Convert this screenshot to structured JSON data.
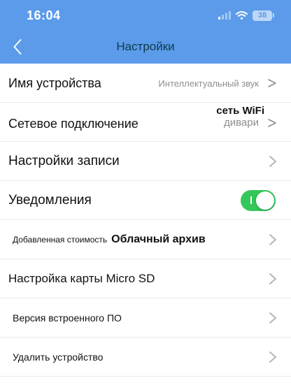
{
  "status_bar": {
    "time": "16:04",
    "battery": "38"
  },
  "header": {
    "title": "Настройки"
  },
  "rows": {
    "device_name": {
      "label": "Имя устройства",
      "value": "Интеллектуальный звук"
    },
    "network": {
      "label": "Сетевое подключение",
      "value_top": "сеть WiFi",
      "value": "дивари"
    },
    "recording": {
      "label": "Настройки записи"
    },
    "notifications": {
      "label": "Уведомления",
      "enabled": true
    },
    "cloud": {
      "label_prefix": "Добавленная стоимость",
      "label_bold": "Облачный архив"
    },
    "sdcard": {
      "label": "Настройка карты Micro SD"
    },
    "firmware": {
      "label": "Версия встроенного ПО"
    },
    "delete": {
      "label": "Удалить устройство"
    }
  },
  "colors": {
    "header": "#5b9bea",
    "toggle_on": "#34c759",
    "chevron": "#b5b5b5"
  },
  "icons": {
    "back": "chevron-left-icon",
    "row_arrow": "chevron-right-icon",
    "signal": "cellular-signal-icon",
    "wifi": "wifi-icon",
    "battery": "battery-icon"
  }
}
